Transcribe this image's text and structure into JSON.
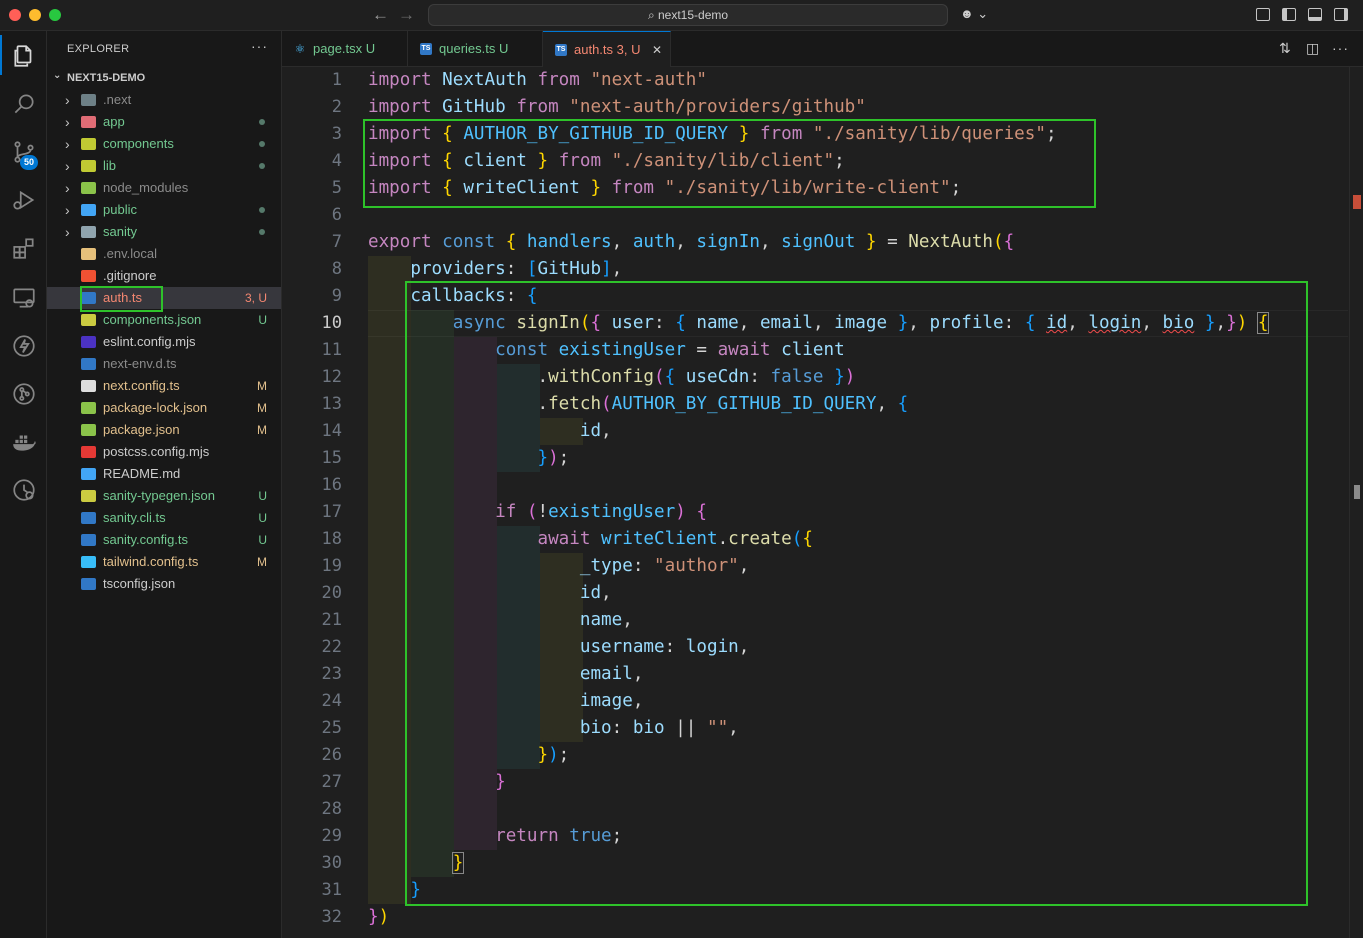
{
  "window": {
    "title": "next15-demo",
    "traffic_colors": [
      "#ff5f57",
      "#febc2e",
      "#28c840"
    ]
  },
  "activity": {
    "scm_badge": "50",
    "items": [
      "files-icon",
      "search-icon",
      "source-control-icon",
      "run-debug-icon",
      "extensions-icon",
      "remote-explorer-icon",
      "lightning-icon",
      "git-graph-icon",
      "docker-icon",
      "timeline-icon"
    ]
  },
  "explorer": {
    "title": "EXPLORER",
    "more": "···",
    "root": "NEXT15-DEMO",
    "files": [
      {
        "name": ".next",
        "type": "folder",
        "icon_color": "#6d8086",
        "text_color": "#8b8b8b",
        "status": "",
        "dot": false
      },
      {
        "name": "app",
        "type": "folder",
        "icon_color": "#e06c75",
        "text_color": "#73c991",
        "status": "",
        "dot": true
      },
      {
        "name": "components",
        "type": "folder",
        "icon_color": "#c0ca33",
        "text_color": "#73c991",
        "status": "",
        "dot": true
      },
      {
        "name": "lib",
        "type": "folder",
        "icon_color": "#c0ca33",
        "text_color": "#73c991",
        "status": "",
        "dot": true
      },
      {
        "name": "node_modules",
        "type": "folder",
        "icon_color": "#8bc34a",
        "text_color": "#8b8b8b",
        "status": "",
        "dot": false
      },
      {
        "name": "public",
        "type": "folder",
        "icon_color": "#42a5f5",
        "text_color": "#73c991",
        "status": "",
        "dot": true
      },
      {
        "name": "sanity",
        "type": "folder",
        "icon_color": "#90a4ae",
        "text_color": "#73c991",
        "status": "",
        "dot": true
      },
      {
        "name": ".env.local",
        "type": "file",
        "icon_color": "#e6c07b",
        "text_color": "#8b8b8b",
        "status": "",
        "dot": false
      },
      {
        "name": ".gitignore",
        "type": "file",
        "icon_color": "#f05133",
        "text_color": "#cccccc",
        "status": "",
        "dot": false
      },
      {
        "name": "auth.ts",
        "type": "file",
        "icon_color": "#3178c6",
        "text_color": "#f48771",
        "status": "3, U",
        "status_color": "#f48771",
        "dot": false,
        "selected": true
      },
      {
        "name": "components.json",
        "type": "file",
        "icon_color": "#cbcb41",
        "text_color": "#73c991",
        "status": "U",
        "status_color": "#73c991",
        "dot": false
      },
      {
        "name": "eslint.config.mjs",
        "type": "file",
        "icon_color": "#4b32c3",
        "text_color": "#cccccc",
        "status": "",
        "dot": false
      },
      {
        "name": "next-env.d.ts",
        "type": "file",
        "icon_color": "#3178c6",
        "text_color": "#8b8b8b",
        "status": "",
        "dot": false
      },
      {
        "name": "next.config.ts",
        "type": "file",
        "icon_color": "#dddddd",
        "text_color": "#e2c08d",
        "status": "M",
        "status_color": "#e2c08d",
        "dot": false
      },
      {
        "name": "package-lock.json",
        "type": "file",
        "icon_color": "#8bc34a",
        "text_color": "#e2c08d",
        "status": "M",
        "status_color": "#e2c08d",
        "dot": false
      },
      {
        "name": "package.json",
        "type": "file",
        "icon_color": "#8bc34a",
        "text_color": "#e2c08d",
        "status": "M",
        "status_color": "#e2c08d",
        "dot": false
      },
      {
        "name": "postcss.config.mjs",
        "type": "file",
        "icon_color": "#e53935",
        "text_color": "#cccccc",
        "status": "",
        "dot": false
      },
      {
        "name": "README.md",
        "type": "file",
        "icon_color": "#42a5f5",
        "text_color": "#cccccc",
        "status": "",
        "dot": false
      },
      {
        "name": "sanity-typegen.json",
        "type": "file",
        "icon_color": "#cbcb41",
        "text_color": "#73c991",
        "status": "U",
        "status_color": "#73c991",
        "dot": false
      },
      {
        "name": "sanity.cli.ts",
        "type": "file",
        "icon_color": "#3178c6",
        "text_color": "#73c991",
        "status": "U",
        "status_color": "#73c991",
        "dot": false
      },
      {
        "name": "sanity.config.ts",
        "type": "file",
        "icon_color": "#3178c6",
        "text_color": "#73c991",
        "status": "U",
        "status_color": "#73c991",
        "dot": false
      },
      {
        "name": "tailwind.config.ts",
        "type": "file",
        "icon_color": "#38bdf8",
        "text_color": "#e2c08d",
        "status": "M",
        "status_color": "#e2c08d",
        "dot": false
      },
      {
        "name": "tsconfig.json",
        "type": "file",
        "icon_color": "#3178c6",
        "text_color": "#cccccc",
        "status": "",
        "dot": false
      }
    ]
  },
  "tabs": [
    {
      "label": "page.tsx",
      "status": "U",
      "icon_color": "#4fc1ff",
      "icon_glyph": "⚛",
      "color": "#73c991",
      "active": false
    },
    {
      "label": "queries.ts",
      "status": "U",
      "icon_color": "#3178c6",
      "icon_glyph": "TS",
      "color": "#73c991",
      "active": false
    },
    {
      "label": "auth.ts",
      "status": "3, U",
      "icon_color": "#3178c6",
      "icon_glyph": "TS",
      "color": "#f48771",
      "active": true,
      "close": "✕"
    }
  ],
  "editor": {
    "current_line": 10,
    "line_count": 32
  }
}
